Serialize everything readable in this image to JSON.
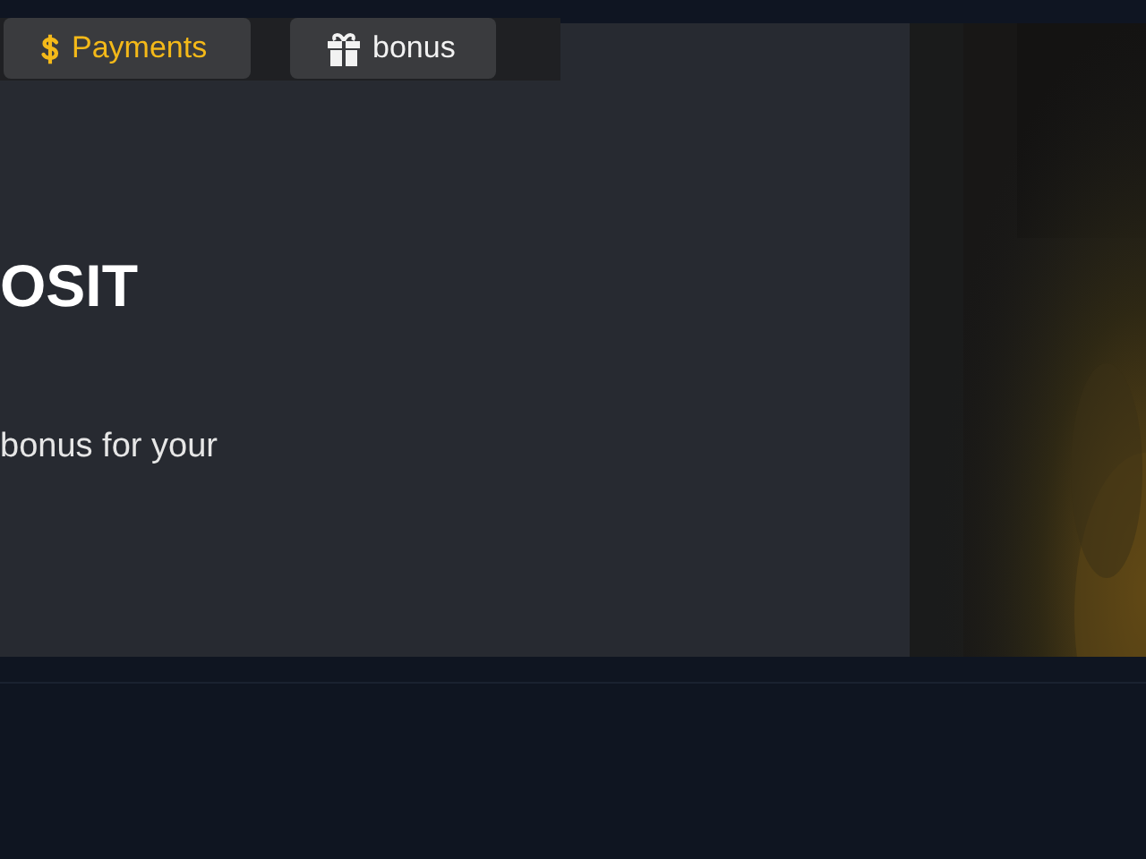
{
  "tabs": [
    {
      "label": "Payments",
      "selected": true
    },
    {
      "label": "bonus",
      "selected": false
    }
  ],
  "banner": {
    "heading": "OSIT",
    "text": "bonus for your"
  }
}
